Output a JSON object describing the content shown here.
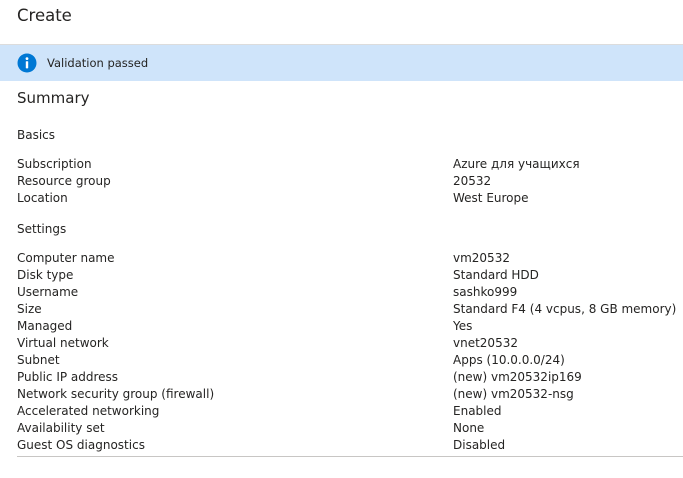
{
  "header": {
    "title": "Create"
  },
  "banner": {
    "icon": "info-icon",
    "text": "Validation passed",
    "color": "#cfe4fa",
    "icon_color": "#0078d4"
  },
  "summary": {
    "title": "Summary",
    "basics": {
      "title": "Basics",
      "rows": [
        {
          "label": "Subscription",
          "value": "Azure для учащихся"
        },
        {
          "label": "Resource group",
          "value": "20532"
        },
        {
          "label": "Location",
          "value": "West Europe"
        }
      ]
    },
    "settings": {
      "title": "Settings",
      "rows": [
        {
          "label": "Computer name",
          "value": "vm20532"
        },
        {
          "label": "Disk type",
          "value": "Standard HDD"
        },
        {
          "label": "Username",
          "value": "sashko999"
        },
        {
          "label": "Size",
          "value": "Standard F4 (4 vcpus, 8 GB memory)"
        },
        {
          "label": "Managed",
          "value": "Yes"
        },
        {
          "label": "Virtual network",
          "value": "vnet20532"
        },
        {
          "label": "Subnet",
          "value": "Apps (10.0.0.0/24)"
        },
        {
          "label": "Public IP address",
          "value": "(new) vm20532ip169"
        },
        {
          "label": "Network security group (firewall)",
          "value": "(new) vm20532-nsg"
        },
        {
          "label": "Accelerated networking",
          "value": "Enabled"
        },
        {
          "label": "Availability set",
          "value": "None"
        },
        {
          "label": "Guest OS diagnostics",
          "value": "Disabled"
        }
      ]
    }
  }
}
